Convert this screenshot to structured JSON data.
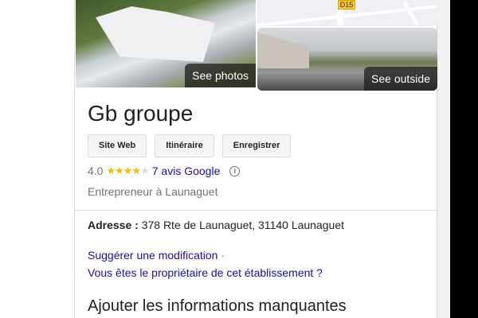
{
  "photos": {
    "see_photos": "See photos",
    "see_outside": "See outside",
    "map_road_label": "D15"
  },
  "business": {
    "name": "Gb groupe",
    "buttons": [
      "Site Web",
      "Itinéraire",
      "Enregistrer"
    ],
    "rating": "4.0",
    "rating_value": 4,
    "rating_max": 5,
    "reviews_link": "7 avis Google",
    "category": "Entrepreneur à Launaguet",
    "address_label": "Adresse :",
    "address": "378 Rte de Launaguet, 31140 Launaguet",
    "suggest_link": "Suggérer une modification",
    "separator": "·",
    "owner_link": "Vous êtes le propriétaire de cet établissement ?",
    "missing_info_heading": "Ajouter les informations manquantes"
  },
  "colors": {
    "link": "#1a0dab",
    "star": "#fbbc04",
    "text_muted": "#70757a"
  }
}
